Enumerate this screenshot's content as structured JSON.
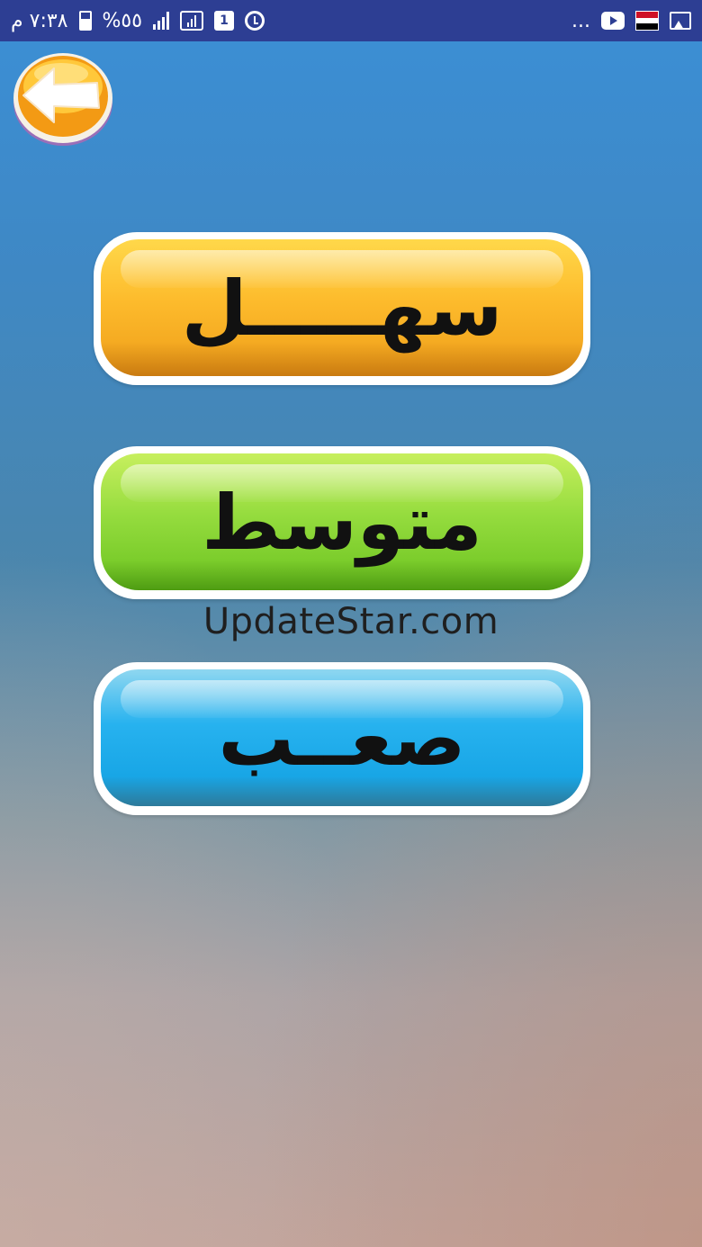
{
  "status_bar": {
    "time": "٧:٣٨ م",
    "battery": "%٥٥",
    "notification_count": "1",
    "overflow": "...",
    "icons": [
      "battery-icon",
      "signal-icon",
      "data-icon",
      "notification-icon",
      "alarm-icon",
      "youtube-icon",
      "egypt-flag-icon",
      "image-icon"
    ],
    "bar_color": "#2d3e93"
  },
  "back_button": {
    "icon": "back-arrow-icon"
  },
  "levels": [
    {
      "label": "سهـــــل",
      "color": "#fdbb2c"
    },
    {
      "label": "متوسط",
      "color": "#8fdc3e"
    },
    {
      "label": "صعــب",
      "color": "#27b2ef"
    }
  ],
  "watermark": "UpdateStar.com"
}
